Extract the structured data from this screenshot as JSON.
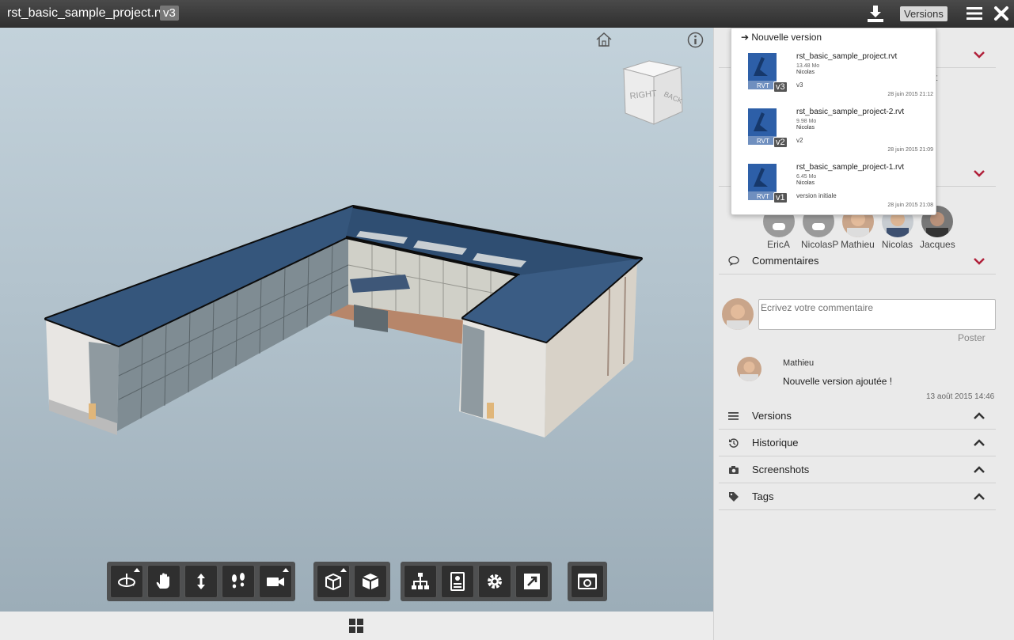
{
  "header": {
    "file_name": "rst_basic_sample_project.rvt",
    "version_badge": "v3",
    "versions_button": "Versions",
    "icons": {
      "download": "download-icon",
      "menu": "hamburger-menu-icon",
      "close": "close-icon"
    }
  },
  "viewer": {
    "viewcube": {
      "face_right": "RIGHT",
      "face_back": "BACK"
    },
    "icons": {
      "home": "home-icon",
      "info": "info-icon"
    },
    "toolbar_groups": [
      [
        "orbit-icon",
        "pan-hand-icon",
        "zoom-arrows-icon",
        "walk-footprints-icon",
        "camera-icon"
      ],
      [
        "section-box-icon",
        "explode-cube-icon"
      ],
      [
        "model-tree-icon",
        "properties-icon",
        "settings-gear-icon",
        "fullscreen-icon"
      ],
      [
        "screenshot-icon"
      ]
    ]
  },
  "versions_dropdown": {
    "new_version": "Nouvelle version",
    "versions": [
      {
        "file": "rst_basic_sample_project.rvt",
        "size": "13.48 Mo",
        "author": "Nicolas",
        "label": "v3",
        "tag": "v3",
        "date": "28 juin 2015 21:12",
        "icon": "RVT"
      },
      {
        "file": "rst_basic_sample_project-2.rvt",
        "size": "9.98 Mo",
        "author": "Nicolas",
        "label": "v2",
        "tag": "v2",
        "date": "28 juin 2015 21:09",
        "icon": "RVT"
      },
      {
        "file": "rst_basic_sample_project-1.rvt",
        "size": "6.45 Mo",
        "author": "Nicolas",
        "label": "version initiale",
        "tag": "v1",
        "date": "28 juin 2015 21:08",
        "icon": "RVT"
      }
    ]
  },
  "sidebar": {
    "ghost_text": "t",
    "people": [
      "EricA",
      "NicolasP",
      "Mathieu",
      "Nicolas",
      "Jacques"
    ],
    "sections": {
      "comments": "Commentaires",
      "versions": "Versions",
      "history": "Historique",
      "screenshots": "Screenshots",
      "tags": "Tags"
    },
    "comment_input": {
      "placeholder": "Ecrivez votre commentaire"
    },
    "post_button": "Poster",
    "comment": {
      "author": "Mathieu",
      "text": "Nouvelle version ajoutée !",
      "date": "13 août 2015 14:46"
    }
  },
  "colors": {
    "accent_chevron": "#b0203a",
    "topbar": "#3a3a3a",
    "roof": "#2f4e72"
  }
}
